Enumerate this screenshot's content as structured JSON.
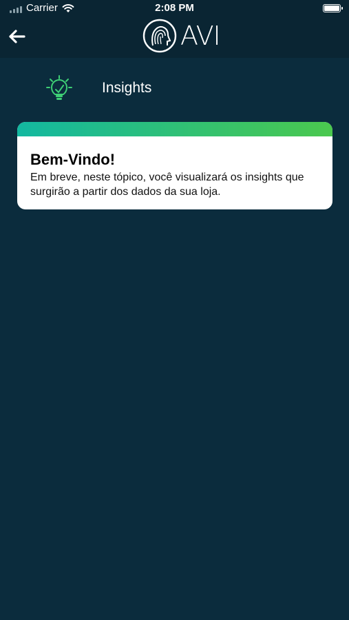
{
  "theme": {
    "background": "#0b2c3d",
    "accent_start": "#13b8a0",
    "accent_end": "#4bc84e"
  },
  "status_bar": {
    "carrier": "Carrier",
    "time": "2:08 PM",
    "battery_level": 1.0
  },
  "nav": {
    "back_icon": "arrow-left-icon",
    "logo_text": "AVI",
    "logo_icon": "fingerprint-head-icon"
  },
  "section": {
    "icon": "lightbulb-check-icon",
    "title": "Insights"
  },
  "card": {
    "title": "Bem-Vindo!",
    "body": "Em breve, neste tópico, você visualizará os insights que surgirão a partir dos dados da sua loja."
  }
}
